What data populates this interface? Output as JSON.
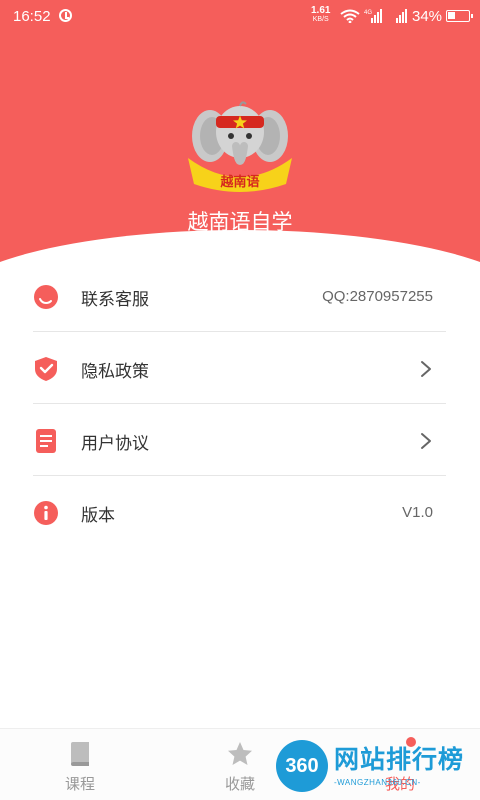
{
  "status_bar": {
    "time": "16:52",
    "net_speed_value": "1.61",
    "net_speed_unit": "KB/S",
    "network_type": "4G",
    "battery": "34%"
  },
  "header": {
    "logo_text": "越南语",
    "app_name": "越南语自学",
    "background_color": "#f55e5b"
  },
  "menu": {
    "items": [
      {
        "icon": "customer-service-icon",
        "label": "联系客服",
        "value": "QQ:2870957255"
      },
      {
        "icon": "shield-icon",
        "label": "隐私政策",
        "value": ""
      },
      {
        "icon": "document-icon",
        "label": "用户协议",
        "value": ""
      },
      {
        "icon": "info-icon",
        "label": "版本",
        "value": "V1.0"
      }
    ]
  },
  "tabbar": {
    "tabs": [
      {
        "icon": "book-icon",
        "label": "课程",
        "active": false
      },
      {
        "icon": "star-icon",
        "label": "收藏",
        "active": false
      },
      {
        "icon": "profile-icon",
        "label": "我的",
        "active": true
      }
    ]
  },
  "watermark": {
    "badge": "360",
    "title": "网站排行榜",
    "subtitle": "-WANGZHAN360.CN-"
  },
  "colors": {
    "accent": "#f55e5b",
    "watermark_blue": "#1e9bd7"
  }
}
